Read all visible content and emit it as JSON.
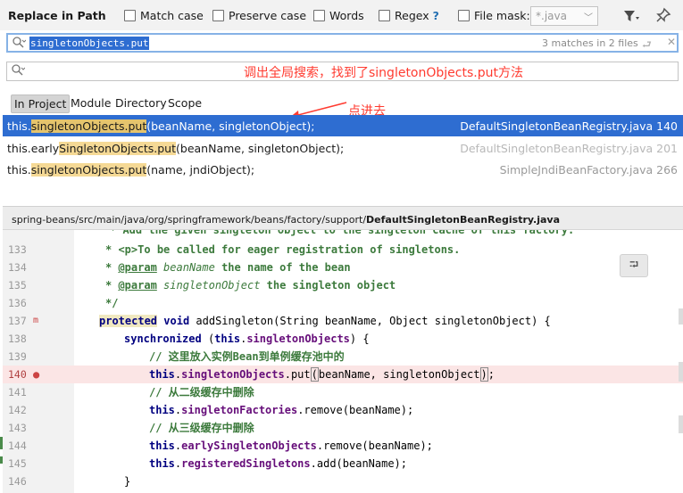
{
  "header": {
    "title": "Replace in Path",
    "options": [
      {
        "id": "match-case",
        "label": "Match case"
      },
      {
        "id": "preserve-case",
        "label": "Preserve case"
      },
      {
        "id": "words",
        "label": "Words"
      },
      {
        "id": "regex",
        "label": "Regex"
      },
      {
        "id": "file-mask",
        "label": "File mask:"
      }
    ],
    "regex_help": "?",
    "file_mask_value": "*.java",
    "file_mask_arrow": "﹀",
    "filter_icon": "▼",
    "pin_icon": "📌"
  },
  "find": {
    "value": "singletonObjects.put",
    "matches": "3 matches in 2 files",
    "search_glyph": "⚲",
    "enter_glyph": "⮐",
    "clear_glyph": "✕"
  },
  "replace": {
    "value": "",
    "search_glyph": "⚲"
  },
  "annotations": {
    "top": "调出全局搜索，找到了singletonObjects.put方法",
    "click": "点进去"
  },
  "scopes": [
    "In Project",
    "Module",
    "Directory",
    "Scope"
  ],
  "results": [
    {
      "pre": "this.",
      "hl": "singletonObjects.put",
      "post": "(beanName, singletonObject);",
      "file": "DefaultSingletonBeanRegistry.java 140"
    },
    {
      "pre": "this.early",
      "hl": "SingletonObjects.put",
      "post": "(beanName, singletonObject);",
      "file": "DefaultSingletonBeanRegistry.java 201"
    },
    {
      "pre": "this.",
      "hl": "singletonObjects.put",
      "post": "(name, jndiObject);",
      "file": "SimpleJndiBeanFactory.java 266"
    }
  ],
  "path": {
    "prefix": "spring-beans/src/main/java/org/springframework/beans/factory/support/",
    "file": "DefaultSingletonBeanRegistry.java"
  },
  "code": {
    "partial_top": "* Add the given singleton object to the singleton cache of this factory.",
    "ln133": "133",
    "l133_p": "<p>",
    "l133_t": "To be called for eager registration of singletons.",
    "ln134": "134",
    "l134_tag": "@param",
    "l134_name": "beanName",
    "l134_t": "the name of the bean",
    "ln135": "135",
    "l135_tag": "@param",
    "l135_name": "singletonObject",
    "l135_t": "the singleton object",
    "ln136": "136",
    "l136_t": "*/",
    "ln137": "137",
    "l137_kw1": "protected",
    "l137_kw2": "void",
    "l137_t": "addSingleton(String beanName, Object singletonObject) {",
    "ln138": "138",
    "l138_kw": "synchronized",
    "l138_a": "(",
    "l138_this": "this",
    "l138_b": ".",
    "l138_fld": "singletonObjects",
    "l138_c": ") {",
    "ln139": "139",
    "l139_cmt": "// 这里放入实例Bean到单例缓存池中的",
    "ln140": "140",
    "l140_this": "this",
    "l140_fld": "singletonObjects",
    "l140_t1": ".put",
    "l140_t2": "(",
    "l140_t3": "beanName, singletonObject",
    "l140_t4": ")",
    "l140_t5": ";",
    "ln141": "141",
    "l141_cmt": "// 从二级缓存中删除",
    "ln142": "142",
    "l142_this": "this",
    "l142_fld": "singletonFactories",
    "l142_t": ".remove(beanName);",
    "ln143": "143",
    "l143_cmt": "// 从三级缓存中删除",
    "ln144": "144",
    "l144_this": "this",
    "l144_fld": "earlySingletonObjects",
    "l144_t": ".remove(beanName);",
    "ln145": "145",
    "l145_this": "this",
    "l145_fld": "registeredSingletons",
    "l145_t": ".add(beanName);",
    "ln146": "146",
    "l146_t": "}",
    "gutter_m": "m",
    "gutter_bp": "●"
  },
  "float_icon": "⮒",
  "colors": {
    "selection": "#2e6dd1",
    "highlight": "#f5d995",
    "annotation": "#ff3b30",
    "current_line": "#fbe5e5"
  }
}
